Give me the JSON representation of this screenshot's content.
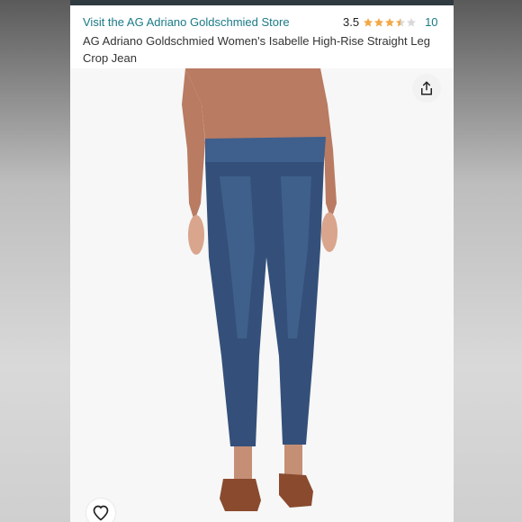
{
  "store_link": "Visit the AG Adriano Goldschmied Store",
  "rating": {
    "value": "3.5",
    "count": "10",
    "stars_filled": 3.5,
    "stars_total": 5,
    "star_color": "#f3a847"
  },
  "product": {
    "title": "AG Adriano Goldschmied Women's Isabelle High-Rise Straight Leg Crop Jean"
  },
  "colors": {
    "link": "#1a7a86",
    "denim": "#34507a",
    "top": "#b97b62"
  },
  "icons": {
    "share": "share-icon",
    "wishlist": "heart-icon"
  }
}
